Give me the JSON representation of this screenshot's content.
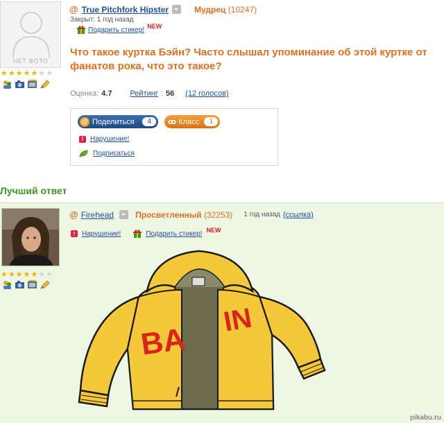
{
  "question": {
    "avatar_caption": "НЕТ ФОТО",
    "author": "True Pitchfork Hipster",
    "rank": "Мудрец",
    "points": "(10247)",
    "closed": "Закрыт: 1 год назад",
    "sticker_link": "Подарить стикер!",
    "new_badge": "NEW",
    "title": "Что такое куртка Бэйн? Часто слышал упоминание об этой куртке от фанатов рока, что это такое?",
    "rating_label": "Оценка:",
    "rating_value": "4.7",
    "score_label": "Рейтинг",
    "score_value": "56",
    "votes": "(12 голосов)",
    "stars": 5
  },
  "share": {
    "share_label": "Поделиться",
    "share_count": "4",
    "class_label": "Класс",
    "class_count": "1",
    "report": "Нарушение!",
    "subscribe": "Подписаться"
  },
  "best_answer": {
    "heading": "Лучший ответ",
    "author": "Firehead",
    "rank": "Просветленный",
    "points": "(32253)",
    "time": "1 год назад",
    "link": "(ссылка)",
    "report": "Нарушение!",
    "sticker_link": "Подарить стикер!",
    "new_badge": "NEW",
    "jacket_text": "BAIN",
    "stars": 5
  },
  "watermark": "pikabu.ru",
  "colors": {
    "accent_orange": "#e07020",
    "link_blue": "#1f4fa0",
    "best_green": "#3a9a1a",
    "answer_bg": "#eef6e4"
  }
}
